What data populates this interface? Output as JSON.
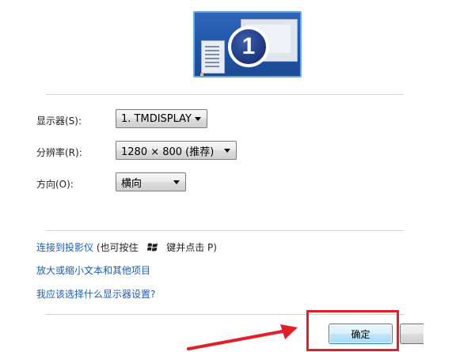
{
  "monitor_preview": {
    "number": "1"
  },
  "settings": {
    "display": {
      "label": "显示器(S):",
      "value": "1. TMDISPLAY"
    },
    "resolution": {
      "label": "分辨率(R):",
      "value": "1280 × 800 (推荐)"
    },
    "orientation": {
      "label": "方向(O):",
      "value": "横向"
    }
  },
  "links": {
    "projector": "连接到投影仪",
    "projector_hint_prefix": "(也可按住",
    "projector_hint_suffix": "键并点击 P)",
    "text_size": "放大或缩小文本和其他项目",
    "help": "我应该选择什么显示器设置?"
  },
  "buttons": {
    "ok": "确定"
  },
  "colors": {
    "annotation": "#e0202a",
    "link": "#1f5dab",
    "monitor_bg": "#2155a6"
  }
}
